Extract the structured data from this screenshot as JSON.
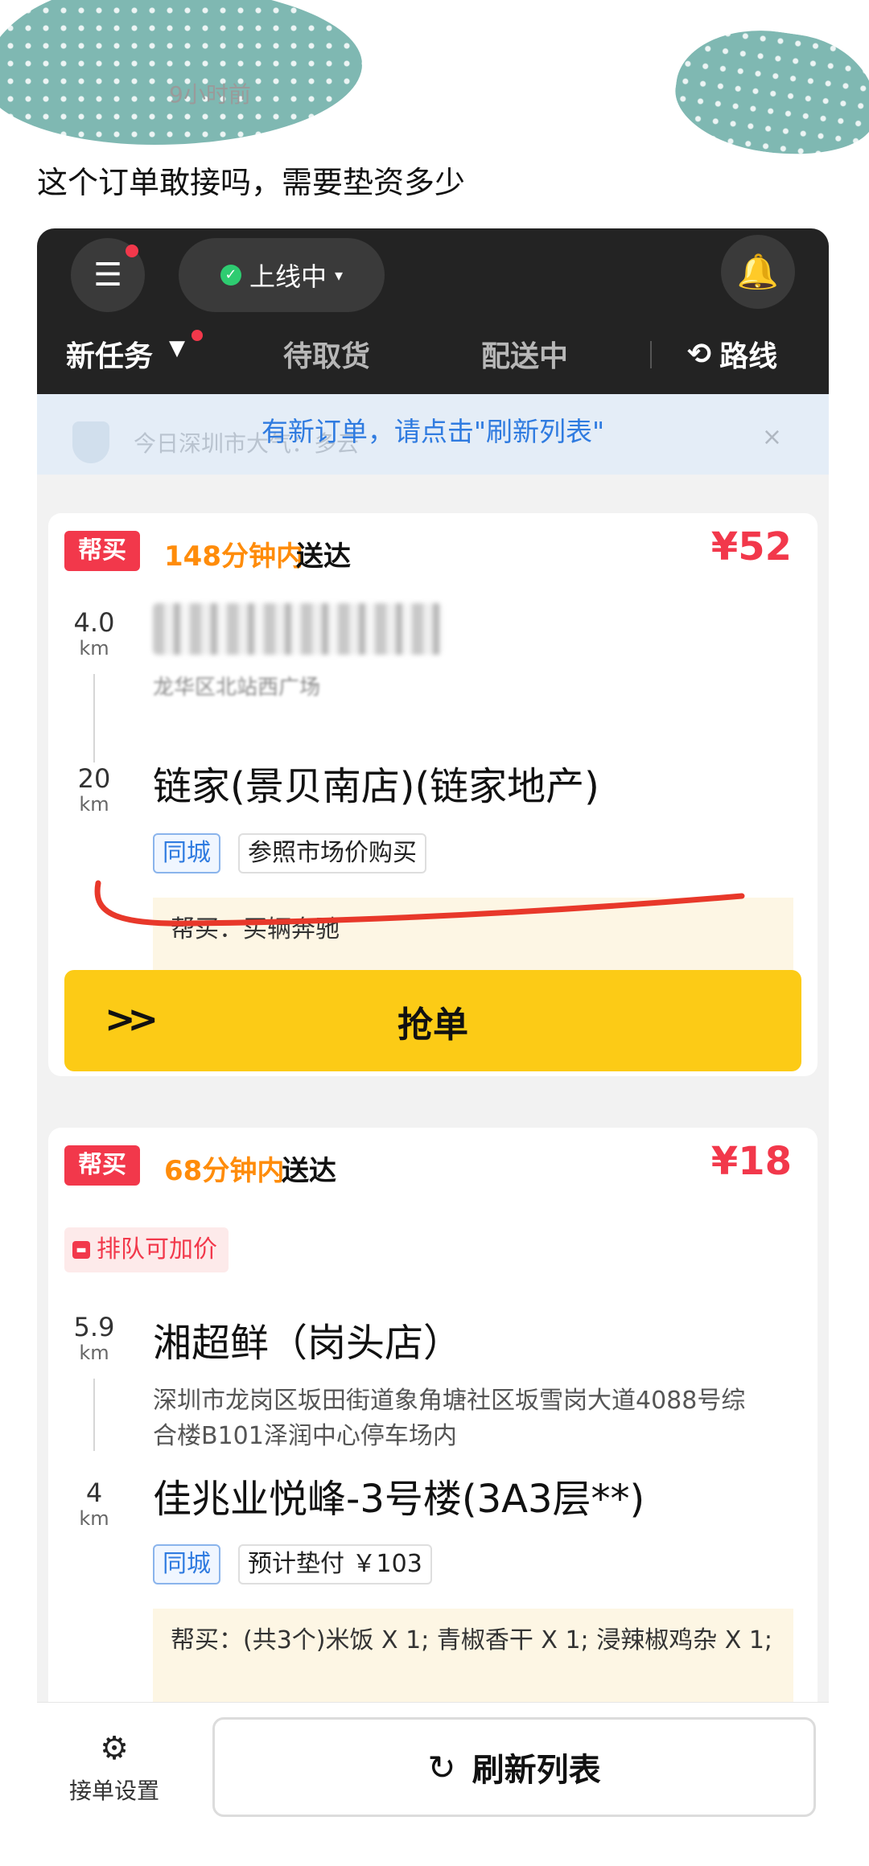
{
  "post": {
    "time": "9小时前",
    "text": "这个订单敢接吗，需要垫资多少"
  },
  "app": {
    "topbar": {
      "menu_icon": "menu-icon",
      "online_status": "上线中",
      "status_color": "#2ecc71",
      "bell_icon": "bell-icon"
    },
    "tabs": [
      {
        "label": "新任务",
        "active": true
      },
      {
        "label": "待取货",
        "active": false
      },
      {
        "label": "配送中",
        "active": false
      },
      {
        "label": "路线",
        "active": false
      }
    ],
    "notice": {
      "main": "有新订单，请点击\"刷新列表\"",
      "sub": "今日深圳市大气：多云",
      "close": "×"
    },
    "orders": [
      {
        "type_tag": "帮买",
        "eta": "148分钟内",
        "eta_suffix": "送达",
        "price": "¥52",
        "pickup_distance": "4.0",
        "pickup_unit": "km",
        "pickup_address_partial": "龙华区北站西广场",
        "dest_distance": "20",
        "dest_unit": "km",
        "dest_name": "链家(景贝南店)(链家地产)",
        "badges": [
          "同城",
          "参照市场价购买"
        ],
        "note": "帮买：买辆奔驰",
        "action": "抢单"
      },
      {
        "type_tag": "帮买",
        "eta": "68分钟内",
        "eta_suffix": "送达",
        "price": "¥18",
        "queue_tag": "排队可加价",
        "pickup_distance": "5.9",
        "pickup_unit": "km",
        "pickup_name": "湘超鲜（岗头店）",
        "pickup_address": "深圳市龙岗区坂田街道象角塘社区坂雪岗大道4088号综合楼B101泽润中心停车场内",
        "dest_distance": "4",
        "dest_unit": "km",
        "dest_name": "佳兆业悦峰-3号楼(3A3层**)",
        "badges": [
          "同城",
          "预计垫付 ￥103"
        ],
        "note": "帮买：(共3个)米饭 X 1; 青椒香干 X 1; 浸辣椒鸡杂 X 1;"
      }
    ],
    "bottom": {
      "settings_label": "接单设置",
      "refresh_label": "刷新列表"
    },
    "colors": {
      "accent_red": "#f2384b",
      "accent_orange": "#ff8c0a",
      "grab_yellow": "#fccb16",
      "link_blue": "#2f7be0",
      "topbar_dark": "#232323"
    }
  }
}
